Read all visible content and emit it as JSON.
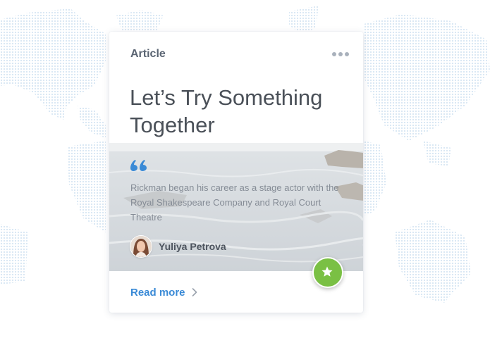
{
  "card": {
    "category": "Article",
    "title": "Let’s Try Something Together",
    "quote": "Rickman began his career as a stage actor with the Royal Shakespeare Company and Royal Court Theatre",
    "author": {
      "name": "Yuliya Petrova"
    },
    "read_more_label": "Read more"
  },
  "icons": {
    "menu": "more-horizontal-icon",
    "quote": "quote-icon",
    "favorite": "star-icon",
    "read_more": "chevron-right-icon"
  },
  "colors": {
    "accent_blue": "#3a8ad6",
    "favorite_green": "#7ac044",
    "map_dots": "#cfe1f1"
  }
}
